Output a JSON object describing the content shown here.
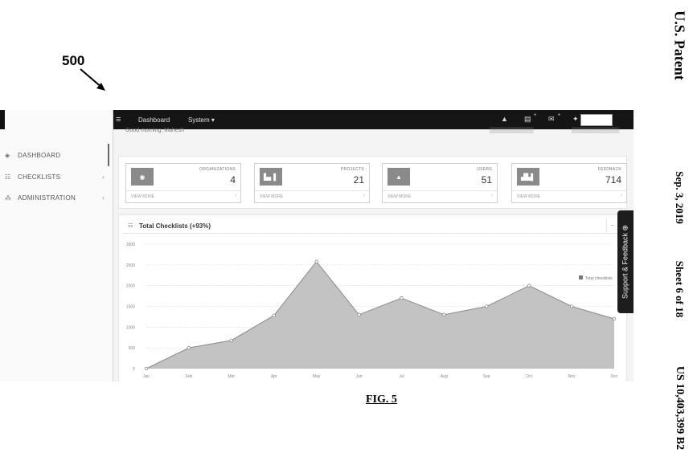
{
  "patent": {
    "title": "U.S. Patent",
    "date": "Sep. 3, 2019",
    "sheet": "Sheet 6 of 18",
    "number": "US 10,403,399 B2"
  },
  "reference_label": "500",
  "figure_caption": "FIG. 5",
  "sidebar": {
    "items": [
      {
        "label": "DASHBOARD",
        "icon": "dashboard-icon",
        "glyph": "◈",
        "chevron": ""
      },
      {
        "label": "CHECKLISTS",
        "icon": "list-icon",
        "glyph": "☷",
        "chevron": "‹"
      },
      {
        "label": "ADMINISTRATION",
        "icon": "sitemap-icon",
        "glyph": "⁂",
        "chevron": "‹"
      }
    ]
  },
  "topbar": {
    "menu_glyph": "≡",
    "dashboard_label": "Dashboard",
    "system_label": "System ▾",
    "alert_glyph": "▲",
    "list_glyph": "▤",
    "mail_glyph": "✉",
    "user_glyph": "✦"
  },
  "header": {
    "greeting": "Good morning, Mahesh"
  },
  "stats": [
    {
      "label": "ORGANIZATIONS",
      "value": "4",
      "icon": "building-icon",
      "glyph": "◉",
      "more": "VIEW MORE"
    },
    {
      "label": "PROJECTS",
      "value": "21",
      "icon": "bar-chart-icon",
      "glyph": "▙▖▌",
      "more": "VIEW MORE"
    },
    {
      "label": "USERS",
      "value": "51",
      "icon": "users-icon",
      "glyph": "▲",
      "more": "VIEW MORE"
    },
    {
      "label": "FEEDBACK",
      "value": "714",
      "icon": "feedback-chart-icon",
      "glyph": "▟▙▌",
      "more": "VIEW MORE"
    }
  ],
  "chart_panel": {
    "title_icon": "☷",
    "title": "Total Checklists (+93%)",
    "collapse_glyph": "–"
  },
  "support_tab": {
    "label": "Support & Feedback ⊕"
  },
  "colors": {
    "topbar": "#151515",
    "area_fill": "#bdbdbd",
    "area_line": "#8c8c8c"
  },
  "chart_data": {
    "type": "area",
    "title": "Total Checklists (+93%)",
    "categories": [
      "Jan",
      "Feb",
      "Mar",
      "Apr",
      "May",
      "Jun",
      "Jul",
      "Aug",
      "Sep",
      "Oct",
      "Nov",
      "Dec"
    ],
    "series": [
      {
        "name": "Total checklists",
        "values": [
          0,
          500,
          680,
          1280,
          2580,
          1300,
          1700,
          1300,
          1500,
          2000,
          1500,
          1200
        ]
      }
    ],
    "yticks": [
      "0",
      "500",
      "1000",
      "1500",
      "2000",
      "2500",
      "3000"
    ],
    "ylim": [
      0,
      3000
    ],
    "grid": true,
    "legend": "top-right"
  }
}
